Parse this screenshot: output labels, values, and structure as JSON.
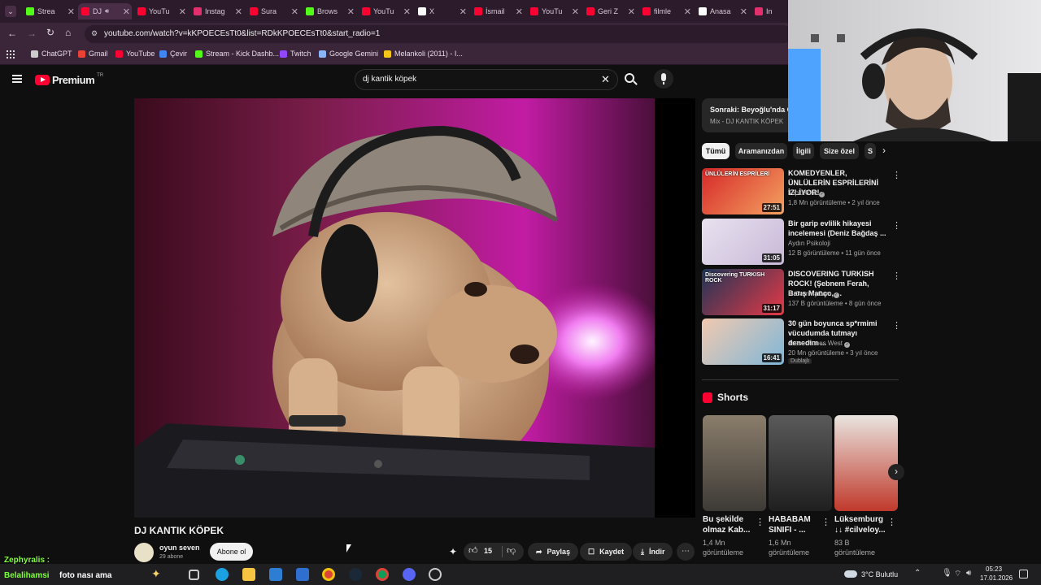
{
  "browser": {
    "tabs": [
      {
        "label": "Strea",
        "color": "#53fc18"
      },
      {
        "label": "DJ",
        "color": "#ff0033"
      },
      {
        "label": "YouTu",
        "color": "#ff0033"
      },
      {
        "label": "Instag",
        "color": "#e1306c"
      },
      {
        "label": "Sura",
        "color": "#ff0033"
      },
      {
        "label": "Brows",
        "color": "#53fc18"
      },
      {
        "label": "YouTu",
        "color": "#ff0033"
      },
      {
        "label": "X",
        "color": "#ffffff"
      },
      {
        "label": "İsmail",
        "color": "#ff0033"
      },
      {
        "label": "YouTu",
        "color": "#ff0033"
      },
      {
        "label": "Geri Z",
        "color": "#ff0033"
      },
      {
        "label": "filmle",
        "color": "#ff0033"
      },
      {
        "label": "Anasa",
        "color": "#ffffff"
      },
      {
        "label": "In",
        "color": "#e1306c"
      }
    ],
    "url": "youtube.com/watch?v=kKPOECEsTt0&list=RDkKPOECEsTt0&start_radio=1",
    "bookmarks": [
      {
        "label": "ChatGPT",
        "color": "#cccccc"
      },
      {
        "label": "Gmail",
        "color": "#ea4335"
      },
      {
        "label": "YouTube",
        "color": "#ff0033"
      },
      {
        "label": "Çevir",
        "color": "#4285f4"
      },
      {
        "label": "Stream - Kick Dashb...",
        "color": "#53fc18"
      },
      {
        "label": "Twitch",
        "color": "#9146ff"
      },
      {
        "label": "Google Gemini",
        "color": "#8ab4f8"
      },
      {
        "label": "Melankoli (2011) - I...",
        "color": "#f5c518"
      }
    ]
  },
  "youtube": {
    "logo_text": "Premium",
    "region": "TR",
    "search_value": "dj kantik köpek",
    "up_next_label": "Sonraki: Beyoğlu'nda Gez",
    "up_next_mix": "Mix - DJ KANTIK KÖPEK",
    "chips": [
      "Tümü",
      "Aramanızdan",
      "İlgili",
      "Size özel",
      "S"
    ],
    "video": {
      "title": "DJ KANTIK KÖPEK",
      "channel": "oyun seven",
      "subs": "29 abone",
      "subscribe_label": "Abone ol",
      "likes": "15",
      "share_label": "Paylaş",
      "save_label": "Kaydet",
      "download_label": "İndir"
    },
    "recommendations": [
      {
        "title": "KOMEDYENLER, ÜNLÜLERİN ESPRİLERİNİ İZLİYOR!",
        "channel": "TepkiKolik",
        "meta": "1,8 Mn görüntüleme • 2 yıl önce",
        "duration": "27:51",
        "thumb_text": "ÜNLÜLERİN ESPRİLERİ",
        "verified": true,
        "c1": "#d62828",
        "c2": "#f4a261"
      },
      {
        "title": "Bir garip evlilik hikayesi incelemesi (Deniz Bağdaş ...",
        "channel": "Aydın Psikoloji",
        "meta": "12 B görüntüleme • 11 gün önce",
        "duration": "31:05",
        "thumb_text": "",
        "verified": false,
        "c1": "#e8e2ef",
        "c2": "#c9b8d8"
      },
      {
        "title": "DISCOVERING TURKISH ROCK! (Şebnem Ferah, Barış Manço, ...",
        "channel": "MrSammyCam",
        "meta": "137 B görüntüleme • 8 gün önce",
        "duration": "31:17",
        "thumb_text": "Discovering TURKISH ROCK",
        "verified": true,
        "c1": "#1d3557",
        "c2": "#e63946"
      },
      {
        "title": "30 gün boyunca sp*rmimi vücudumda tutmayı denedim ...",
        "channel": "Jesse James West",
        "meta": "20 Mn görüntüleme • 3 yıl önce",
        "duration": "16:41",
        "thumb_text": "",
        "verified": true,
        "dubbed": "Dublajlı",
        "c1": "#f1c9b0",
        "c2": "#7fb7d8"
      }
    ],
    "shorts_heading": "Shorts",
    "shorts": [
      {
        "title": "Bu şekilde olmaz Kab...",
        "meta": "1,4 Mn görüntüleme",
        "c1": "#8a7d6b",
        "c2": "#3d3a36"
      },
      {
        "title": "HABABAM SINIFI - ...",
        "meta": "1,6 Mn görüntüleme",
        "c1": "#5a5a5a",
        "c2": "#1f1f1f"
      },
      {
        "title": "Lüksemburg ↓↓ #cilveloy...",
        "meta": "83 B görüntüleme",
        "c1": "#e9e4df",
        "c2": "#c0392b"
      }
    ]
  },
  "overlay": {
    "chat_user": "Zephyralis :",
    "chat_line": "foto nası ama",
    "chat_user2": "Belalihamsi"
  },
  "taskbar": {
    "weather": "3°C Bulutlu",
    "time": "05:23",
    "date": "17.01.2026"
  }
}
